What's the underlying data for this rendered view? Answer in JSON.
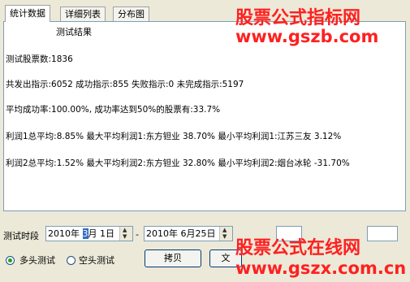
{
  "tabs": [
    {
      "label": "统计数据",
      "active": true
    },
    {
      "label": "详细列表",
      "active": false
    },
    {
      "label": "分布图",
      "active": false
    }
  ],
  "results": {
    "title": "测试结果",
    "lines": [
      "测试股票数:1836",
      "共发出指示:6052 成功指示:855 失败指示:0 未完成指示:5197",
      "平均成功率:100.00%, 成功率达到50%的股票有:33.7%",
      "利润1总平均:8.85% 最大平均利润1:东方钽业 38.70% 最小平均利润1:江苏三友 3.12%",
      "利润2总平均:1.52% 最大平均利润2:东方钽业 32.80% 最小平均利润2:烟台冰轮 -31.70%"
    ]
  },
  "watermarks": {
    "top_line1": "股票公式指标网",
    "top_line2": "www.gszb.com",
    "bottom_line1": "股票公式在线网",
    "bottom_line2": "www.gszx.com.cn"
  },
  "controls": {
    "period_label": "测试时段",
    "start_date": {
      "pre": "2010年 ",
      "sel": "3",
      "post": "月  1日"
    },
    "separator": "-",
    "end_date": "2010年  6月25日",
    "option_long": "多头测试",
    "option_short": "空头测试",
    "selected_option": "long",
    "copy_button": "拷贝",
    "partial_button": "文"
  },
  "colors": {
    "watermark": "#ff2020",
    "panel_border": "#7f9db9",
    "background": "#ece9d8"
  }
}
